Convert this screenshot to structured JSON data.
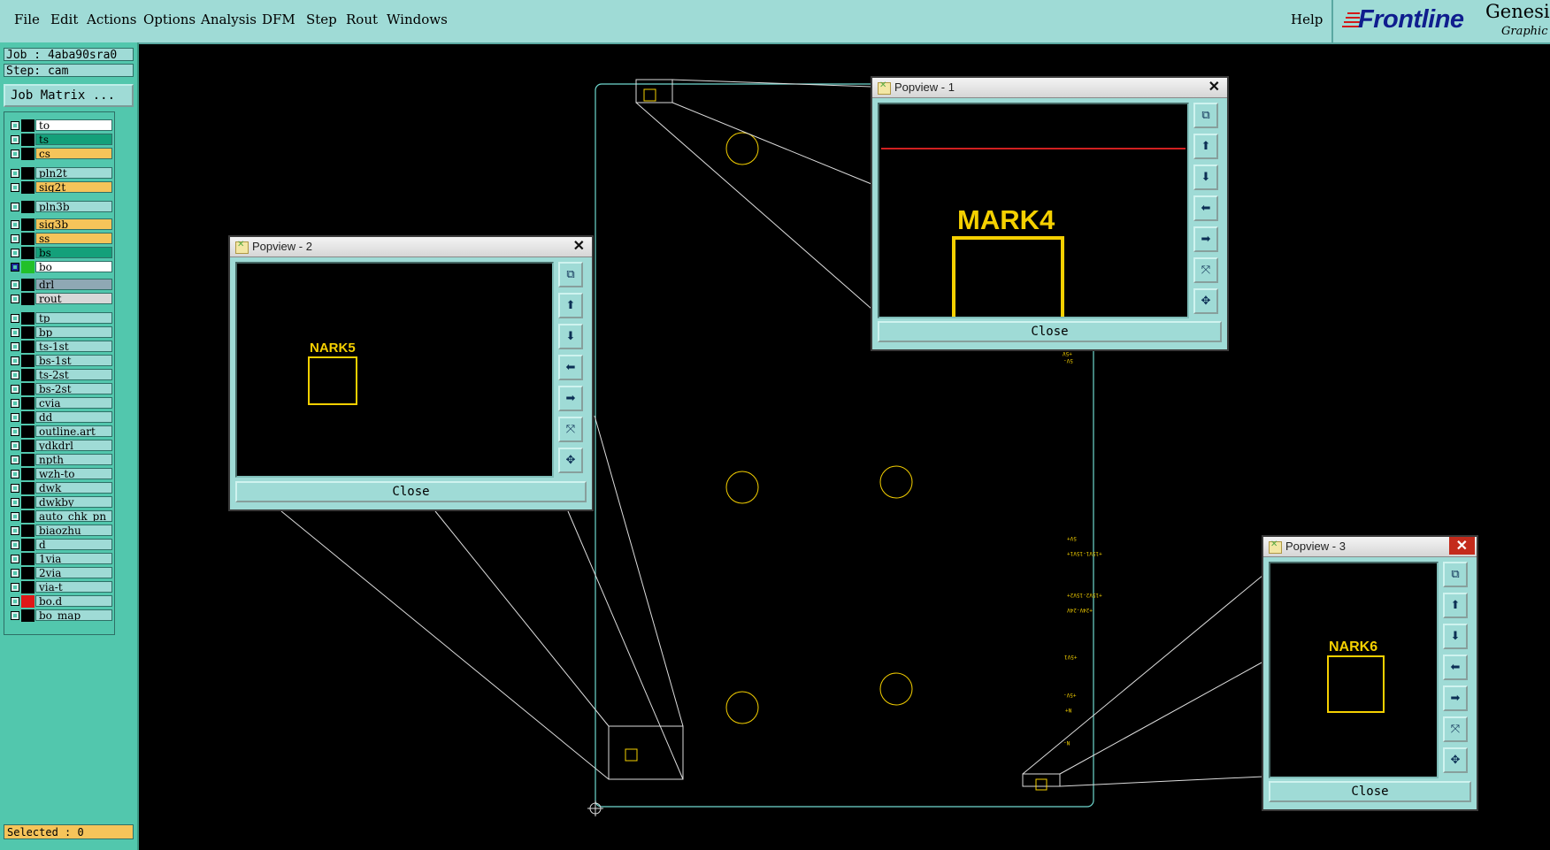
{
  "menubar": {
    "items": [
      "File",
      "Edit",
      "Actions",
      "Options",
      "Analysis",
      "DFM",
      "Step",
      "Rout",
      "Windows"
    ],
    "help": "Help",
    "logo_brand": "Frontline",
    "logo_product": "Genesis",
    "logo_sub": "Graphic"
  },
  "panel": {
    "job": "Job : 4aba90sra0",
    "step": "Step: cam",
    "job_matrix_label": "Job Matrix ...",
    "selected": "Selected : 0"
  },
  "layers": [
    {
      "name": "to",
      "color": "#ffffff"
    },
    {
      "name": "ts",
      "color": "#14a07a"
    },
    {
      "name": "cs",
      "color": "#f5c45a"
    },
    {
      "name": "pln2t",
      "color": "#9fdbd6"
    },
    {
      "name": "sig2t",
      "color": "#f5c45a"
    },
    {
      "name": "pln3b",
      "color": "#9fdbd6"
    },
    {
      "name": "sig3b",
      "color": "#f5c45a"
    },
    {
      "name": "ss",
      "color": "#f5c45a"
    },
    {
      "name": "bs",
      "color": "#14a07a"
    },
    {
      "name": "bo",
      "color": "#ffffff"
    },
    {
      "name": "drl",
      "color": "#8fa8b4"
    },
    {
      "name": "rout",
      "color": "#d8d8d8"
    },
    {
      "name": "tp",
      "color": "#9fdbd6"
    },
    {
      "name": "bp",
      "color": "#9fdbd6"
    },
    {
      "name": "ts-1st",
      "color": "#9fdbd6"
    },
    {
      "name": "bs-1st",
      "color": "#9fdbd6"
    },
    {
      "name": "ts-2st",
      "color": "#9fdbd6"
    },
    {
      "name": "bs-2st",
      "color": "#9fdbd6"
    },
    {
      "name": "cvia",
      "color": "#9fdbd6"
    },
    {
      "name": "dd",
      "color": "#9fdbd6"
    },
    {
      "name": "outline.art",
      "color": "#9fdbd6"
    },
    {
      "name": "ydkdrl",
      "color": "#9fdbd6"
    },
    {
      "name": "npth",
      "color": "#9fdbd6"
    },
    {
      "name": "wzh-to",
      "color": "#9fdbd6"
    },
    {
      "name": "dwk",
      "color": "#9fdbd6"
    },
    {
      "name": "dwkby",
      "color": "#9fdbd6"
    },
    {
      "name": "auto_chk_pn",
      "color": "#9fdbd6"
    },
    {
      "name": "biaozhu",
      "color": "#9fdbd6"
    },
    {
      "name": "d",
      "color": "#9fdbd6"
    },
    {
      "name": "1via",
      "color": "#9fdbd6"
    },
    {
      "name": "2via",
      "color": "#9fdbd6"
    },
    {
      "name": "via-t",
      "color": "#9fdbd6"
    },
    {
      "name": "bo.d",
      "color": "#9fdbd6"
    },
    {
      "name": "bo_map",
      "color": "#9fdbd6"
    }
  ],
  "popviews": [
    {
      "title": "Popview - 1",
      "mark": "MARK4",
      "close": "Close"
    },
    {
      "title": "Popview - 2",
      "mark": "NARK5",
      "close": "Close"
    },
    {
      "title": "Popview - 3",
      "mark": "NARK6",
      "close": "Close"
    }
  ],
  "board_labels": [
    "+5V",
    "5V-",
    "5V+",
    "+15V1-15V1+",
    "+15V2-15V2+",
    "+24V-24V",
    "+5V1",
    "+5V-",
    "N+",
    "N-"
  ],
  "colors": {
    "ui_bg": "#9fdbd6",
    "panel_bg": "#52c7ad",
    "board_outline": "#6fd8cf",
    "features": "#f5d000"
  }
}
